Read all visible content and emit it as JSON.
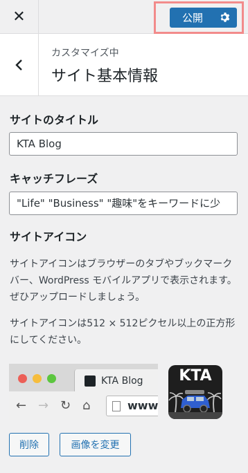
{
  "topbar": {
    "close_symbol": "✕",
    "publish_label": "公開",
    "publish_highlight_color": "#f28b8b",
    "publish_color": "#2271b1"
  },
  "header": {
    "customizing_label": "カスタマイズ中",
    "section_title": "サイト基本情報"
  },
  "site_title": {
    "label": "サイトのタイトル",
    "value": "KTA Blog"
  },
  "tagline": {
    "label": "キャッチフレーズ",
    "value": "\"Life\" \"Business\" \"趣味\"をキーワードに少"
  },
  "site_icon": {
    "label": "サイトアイコン",
    "description_1": "サイトアイコンはブラウザーのタブやブックマークバー、WordPress モバイルアプリで表示されます。ぜひアップロードしましょう。",
    "description_2": "サイトアイコンは512 × 512ピクセル以上の正方形にしてください。",
    "preview_tab_title": "KTA Blog",
    "preview_url": "www.",
    "icon_text": "KTA",
    "remove_label": "削除",
    "change_label": "画像を変更"
  }
}
